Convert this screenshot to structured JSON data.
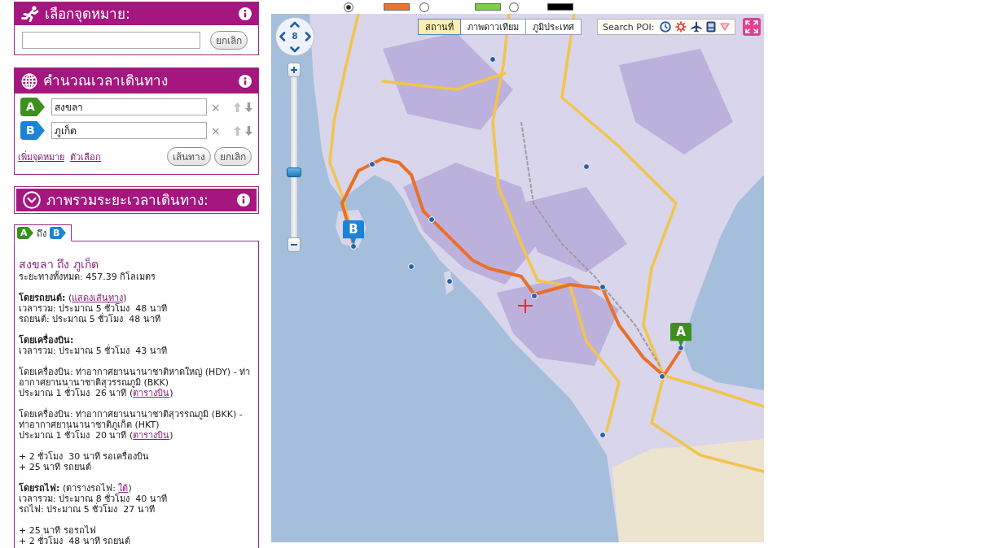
{
  "route_options": [
    {
      "selected": true,
      "color": "#e8772e"
    },
    {
      "selected": false,
      "color": "#80d040"
    },
    {
      "selected": false,
      "color": "#000000"
    }
  ],
  "destination_panel": {
    "title": "เลือกจุดหมาย:",
    "cancel_button": "ยกเลิก"
  },
  "travel_time_panel": {
    "title": "คำนวณเวลาเดินทาง",
    "waypoints": [
      {
        "badge": "A",
        "color": "#3d8f1f",
        "value": "สงขลา",
        "remove": "×"
      },
      {
        "badge": "B",
        "color": "#1c84d8",
        "value": "ภูเก็ต",
        "remove": "×"
      }
    ],
    "links": [
      "เพิ่มจุดหมาย",
      "ตัวเลือก"
    ],
    "buttons": [
      "เส้นทาง",
      "ยกเลิก"
    ]
  },
  "summary_panel": {
    "title": "ภาพรวมระยะเวลาเดินทาง:",
    "tab": {
      "selected": true,
      "label": "ถึง",
      "badges": [
        {
          "label": "A",
          "color": "#3d8f1f"
        },
        {
          "label": "B",
          "color": "#1c84d8"
        }
      ]
    },
    "heading": "สงขลา ถึง ภูเก็ต",
    "distance": "ระยะทางทั้งหมด: 457.39 กิโลเมตร",
    "paragraphs": [
      [
        [
          {
            "text": "**โดยรถยนต์:** ("
          },
          {
            "link": "แสดงเส้นทาง"
          },
          {
            "text": ")"
          }
        ],
        [
          {
            "text": "เวลารวม: ประมาณ 5 ชั่วโมง  48 นาที"
          }
        ],
        [
          {
            "text": "รถยนต์: ประมาณ 5 ชั่วโมง  48 นาที"
          }
        ]
      ],
      [
        [
          {
            "text": "**โดยเครื่องบิน:**"
          }
        ],
        [
          {
            "text": "เวลารวม: ประมาณ 5 ชั่วโมง  43 นาที"
          }
        ]
      ],
      [
        [
          {
            "text": "โดยเครื่องบิน: ท่าอากาศยานนานาชาติหาดใหญ่ (HDY) - ท่าอากาศยานนานาชาติสุวรรณภูมิ (BKK)"
          }
        ],
        [
          {
            "text": "ประมาณ 1 ชั่วโมง  26 นาที ("
          },
          {
            "link": "ตารางบิน"
          },
          {
            "text": ")"
          }
        ]
      ],
      [
        [
          {
            "text": "โดยเครื่องบิน: ท่าอากาศยานนานาชาติสุวรรณภูมิ (BKK) - ท่าอากาศยานนานาชาติภูเก็ต (HKT)"
          }
        ],
        [
          {
            "text": "ประมาณ 1 ชั่วโมง  20 นาที ("
          },
          {
            "link": "ตารางบิน"
          },
          {
            "text": ")"
          }
        ]
      ],
      [
        [
          {
            "text": "+ 2 ชั่วโมง  30 นาที รอเครื่องบิน"
          }
        ],
        [
          {
            "text": "+ 25 นาที รถยนต์"
          }
        ]
      ],
      [
        [
          {
            "text": "**โดยรถไฟ:** (ตารางรถไฟ: "
          },
          {
            "link": "ใต้"
          },
          {
            "text": ")"
          }
        ],
        [
          {
            "text": "เวลารวม: ประมาณ 8 ชั่วโมง  40 นาที"
          }
        ],
        [
          {
            "text": "รถไฟ: ประมาณ 5 ชั่วโมง  27 นาที"
          }
        ]
      ],
      [
        [
          {
            "text": "+ 25 นาที รอรถไฟ"
          }
        ],
        [
          {
            "text": "+ 2 ชั่วโมง  48 นาที รถยนต์"
          }
        ]
      ]
    ]
  },
  "map": {
    "zoom_level": "8",
    "zoom_slider": {
      "level": 0.4
    },
    "view_tabs": [
      {
        "label": "สถานที่",
        "selected": true
      },
      {
        "label": "ภาพดาวเทียม",
        "selected": false
      },
      {
        "label": "ภูมิประเทศ",
        "selected": false
      }
    ],
    "poi_search": "Search POI:",
    "markers": [
      {
        "label": "B",
        "color": "#1c84d8"
      },
      {
        "label": "A",
        "color": "#3d8f1f"
      }
    ]
  }
}
